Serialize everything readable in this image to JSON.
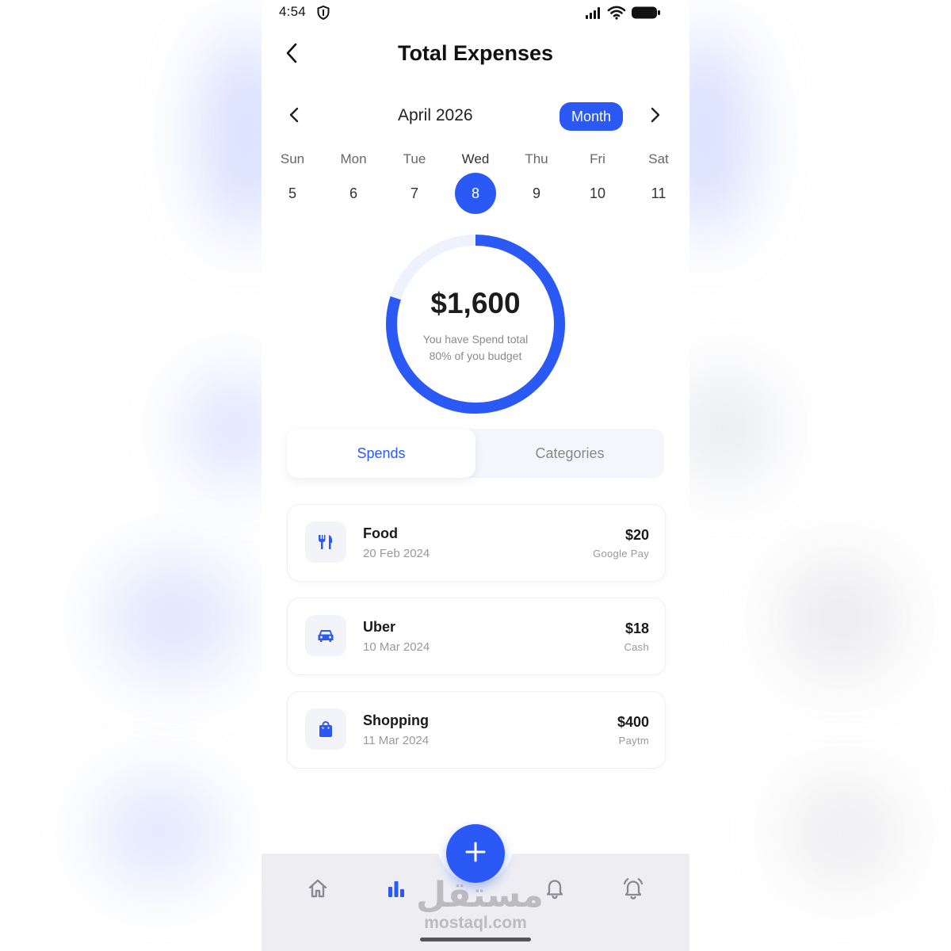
{
  "status": {
    "time": "4:54"
  },
  "header": {
    "title": "Total Expenses"
  },
  "calendar": {
    "month_label": "April 2026",
    "period_button": "Month",
    "days": [
      {
        "name": "Sun",
        "num": "5"
      },
      {
        "name": "Mon",
        "num": "6"
      },
      {
        "name": "Tue",
        "num": "7"
      },
      {
        "name": "Wed",
        "num": "8"
      },
      {
        "name": "Thu",
        "num": "9"
      },
      {
        "name": "Fri",
        "num": "10"
      },
      {
        "name": "Sat",
        "num": "11"
      }
    ],
    "selected_index": 3
  },
  "summary": {
    "amount": "$1,600",
    "caption_line1": "You have Spend total",
    "caption_line2": "80% of you budget",
    "budget_fraction": 0.8
  },
  "tabs": [
    {
      "label": "Spends",
      "active": true
    },
    {
      "label": "Categories",
      "active": false
    }
  ],
  "spends": [
    {
      "name": "Food",
      "date": "20 Feb 2024",
      "amount": "$20",
      "method": "Google Pay",
      "icon": "fork-knife-icon"
    },
    {
      "name": "Uber",
      "date": "10 Mar 2024",
      "amount": "$18",
      "method": "Cash",
      "icon": "car-icon"
    },
    {
      "name": "Shopping",
      "date": "11 Mar 2024",
      "amount": "$400",
      "method": "Paytm",
      "icon": "shopping-bag-icon"
    }
  ],
  "nav": {
    "items": [
      "home-icon",
      "bar-chart-icon",
      "bell-icon",
      "alarm-icon"
    ],
    "active_index": 1
  },
  "watermark": {
    "arabic": "مستقل",
    "latin": "mostaql.com"
  },
  "colors": {
    "accent": "#2b59f5",
    "ring_track": "#eef2fc",
    "nav_background": "#eeeef2"
  }
}
